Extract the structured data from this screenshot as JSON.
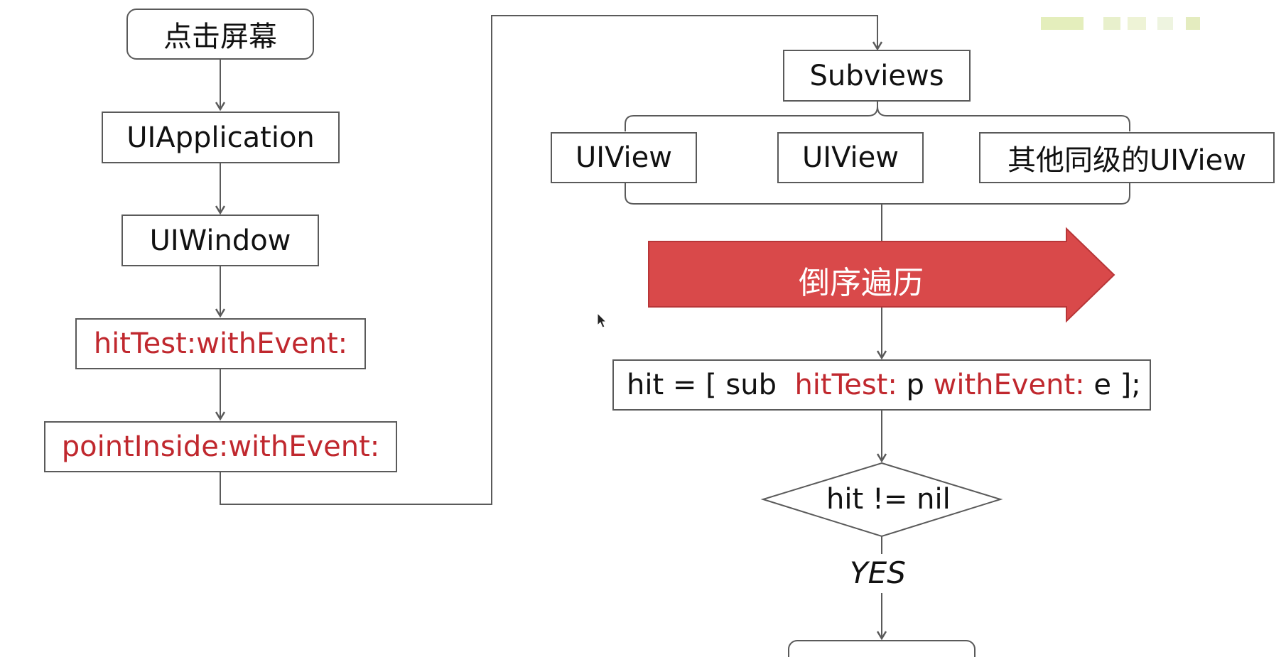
{
  "left_flow": {
    "tap": "点击屏幕",
    "uiapplication": "UIApplication",
    "uiwindow": "UIWindow",
    "hittest": "hitTest:withEvent:",
    "pointinside": "pointInside:withEvent:"
  },
  "right_flow": {
    "subviews": "Subviews",
    "uiview_1": "UIView",
    "uiview_2": "UIView",
    "sibling_views": "其他同级的UIView",
    "reverse_traverse": "倒序遍历",
    "code": {
      "part1": "hit = [ sub  ",
      "part2": "hitTest:",
      "part3": " p ",
      "part4": "withEvent:",
      "part5": " e ];"
    },
    "condition": "hit != nil",
    "yes_label": "YES"
  },
  "colors": {
    "line": "#5a5a5a",
    "red_text": "#c0282e",
    "arrow_fill": "#d9494a"
  }
}
